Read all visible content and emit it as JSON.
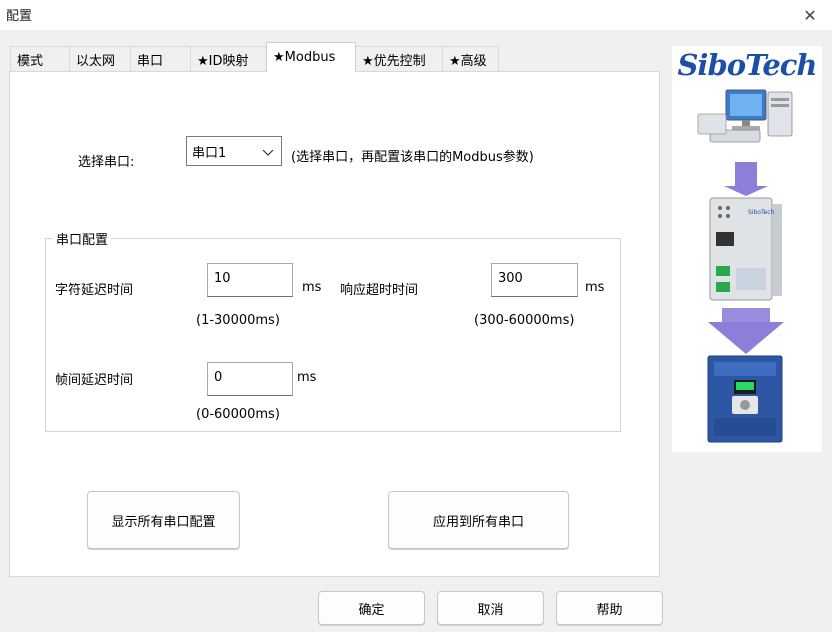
{
  "window": {
    "title": "配置",
    "close_glyph": "✕"
  },
  "tabs": [
    {
      "label": "模式",
      "active": false
    },
    {
      "label": "以太网",
      "active": false
    },
    {
      "label": "串口",
      "active": false
    },
    {
      "label": "★ID映射",
      "active": false
    },
    {
      "label": "★Modbus",
      "active": true
    },
    {
      "label": "★优先控制",
      "active": false
    },
    {
      "label": "★高级",
      "active": false
    }
  ],
  "port_select": {
    "label": "选择串口:",
    "value": "串口1",
    "hint": "(选择串口，再配置该串口的Modbus参数)"
  },
  "serial_config": {
    "title": "串口配置",
    "char_delay": {
      "label": "字符延迟时间",
      "value": "10",
      "unit": "ms",
      "range": "(1-30000ms)"
    },
    "response_timeout": {
      "label": "响应超时时间",
      "value": "300",
      "unit": "ms",
      "range": "(300-60000ms)"
    },
    "frame_delay": {
      "label": "帧间延迟时间",
      "value": "0",
      "unit": "ms",
      "range": "(0-60000ms)"
    }
  },
  "actions": {
    "show_all": "显示所有串口配置",
    "apply_all": "应用到所有串口"
  },
  "footer": {
    "ok": "确定",
    "cancel": "取消",
    "help": "帮助"
  },
  "brand": {
    "name": "SiboTech",
    "color": "#1d4fa8"
  },
  "icons": [
    "close-icon",
    "chevron-down-icon",
    "computer-icon",
    "arrow-down-icon",
    "gateway-device-icon",
    "inverter-device-icon"
  ]
}
